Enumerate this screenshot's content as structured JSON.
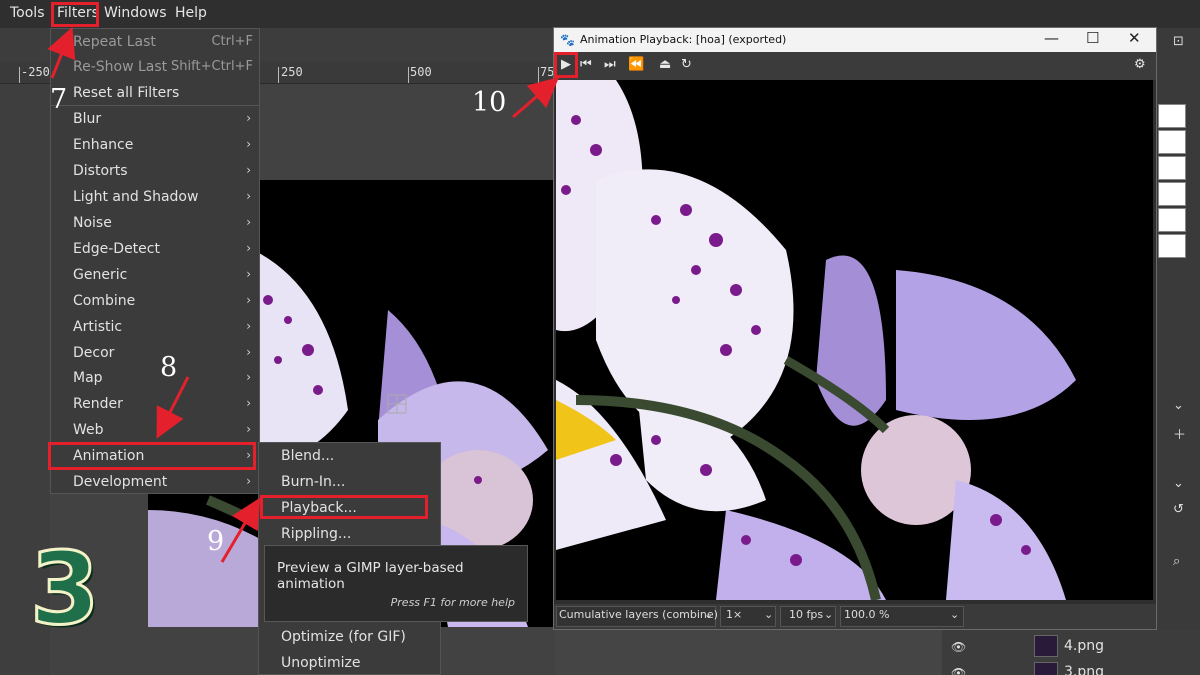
{
  "menubar": {
    "items": [
      "Tools",
      "Filters",
      "Windows",
      "Help"
    ]
  },
  "ruler": {
    "labels": [
      "-250",
      "250",
      "500",
      "75"
    ]
  },
  "filters_menu": {
    "items": [
      {
        "label": "Repeat Last",
        "shortcut": "Ctrl+F",
        "dim": true
      },
      {
        "label": "Re-Show Last",
        "shortcut": "Shift+Ctrl+F",
        "dim": true
      },
      {
        "label": "Reset all Filters"
      },
      {
        "label": "Blur",
        "submenu": true
      },
      {
        "label": "Enhance",
        "submenu": true
      },
      {
        "label": "Distorts",
        "submenu": true
      },
      {
        "label": "Light and Shadow",
        "submenu": true
      },
      {
        "label": "Noise",
        "submenu": true
      },
      {
        "label": "Edge-Detect",
        "submenu": true
      },
      {
        "label": "Generic",
        "submenu": true
      },
      {
        "label": "Combine",
        "submenu": true
      },
      {
        "label": "Artistic",
        "submenu": true
      },
      {
        "label": "Decor",
        "submenu": true
      },
      {
        "label": "Map",
        "submenu": true
      },
      {
        "label": "Render",
        "submenu": true
      },
      {
        "label": "Web",
        "submenu": true
      },
      {
        "label": "Animation",
        "submenu": true,
        "highlighted": true
      },
      {
        "label": "Development",
        "submenu": true
      }
    ]
  },
  "animation_submenu": {
    "items": [
      "Blend...",
      "Burn-In...",
      "Playback...",
      "Rippling...",
      "Optimize (for GIF)",
      "Unoptimize"
    ]
  },
  "tooltip": {
    "text": "Preview a GIMP layer-based animation",
    "help": "Press F1 for more help"
  },
  "playback_window": {
    "title": "Animation Playback: [hoa] (exported)",
    "status": {
      "mode": "Cumulative layers (combine)",
      "speed": "1×",
      "fps": "10 fps",
      "zoom": "100.0 %"
    }
  },
  "layers": [
    "4.png",
    "3.png"
  ],
  "annotations": {
    "steps": [
      "7",
      "8",
      "9",
      "10"
    ],
    "big_number": "3"
  },
  "colors": {
    "highlight": "#e3202c",
    "arrow": "#e3202c"
  }
}
